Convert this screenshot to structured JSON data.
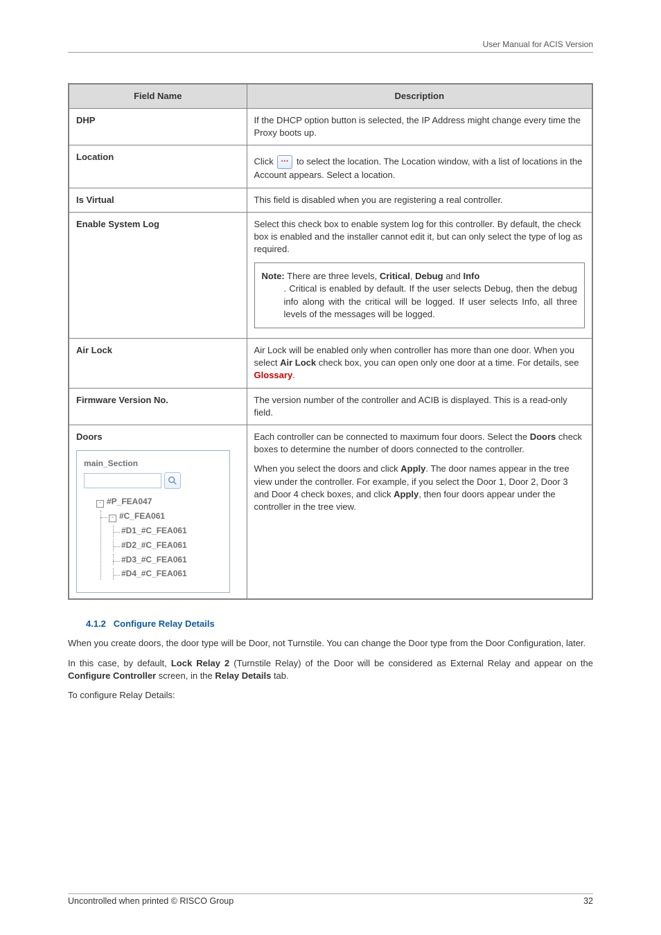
{
  "header": {
    "title": "User Manual for ACIS Version"
  },
  "table": {
    "headers": {
      "field": "Field Name",
      "desc": "Description"
    },
    "rows": {
      "dhp": {
        "label": "DHP",
        "desc": "If the DHCP option button is selected, the IP Address might change every time the Proxy boots up."
      },
      "location": {
        "label": "Location",
        "desc_pre": "Click ",
        "desc_post": " to select the location. The Location window, with a list of locations in the Account appears. Select a location."
      },
      "is_virtual": {
        "label": "Is Virtual",
        "desc": "This field is disabled when you are registering a real controller."
      },
      "enable_log": {
        "label": "Enable System Log",
        "desc": "Select this check box to enable system log for this controller. By default, the check box is enabled and the installer cannot edit it, but can only select the type of log as required.",
        "note_label": "Note:",
        "note_pre": " There are three levels, ",
        "note_c": "Critical",
        "note_sep1": ", ",
        "note_d": "Debug",
        "note_sep2": " and ",
        "note_i": "Info",
        "note_post": ". Critical is enabled by default. If the user selects Debug, then the debug info along with the critical will be logged. If user selects Info, all three levels of the messages will be logged."
      },
      "air_lock": {
        "label": "Air Lock",
        "desc_pre": "Air Lock will be enabled only when controller has more than one door. When you select ",
        "desc_bold": "Air Lock",
        "desc_mid": " check box, you can open only one door at a time. For details, see ",
        "glossary": "Glossary",
        "desc_post": "."
      },
      "fw": {
        "label": "Firmware Version No.",
        "desc": "The version number of the controller and ACIB is displayed. This is a read-only field."
      },
      "doors": {
        "label": "Doors",
        "p1_pre": "Each controller can be connected to maximum four doors. Select the ",
        "p1_bold": "Doors",
        "p1_post": " check boxes to determine the number of doors connected to the controller.",
        "p2_pre": "When you select the doors and click ",
        "p2_b1": "Apply",
        "p2_mid": ". The door names appear in the tree view under the controller. For example, if you select the Door 1, Door 2, Door 3 and Door 4 check boxes, and click ",
        "p2_b2": "Apply",
        "p2_post": ", then four doors appear under the controller in the tree view.",
        "tree": {
          "root": "main_Section",
          "p": "#P_FEA047",
          "c": "#C_FEA061",
          "d1": "#D1_#C_FEA061",
          "d2": "#D2_#C_FEA061",
          "d3": "#D3_#C_FEA061",
          "d4": "#D4_#C_FEA061"
        }
      }
    }
  },
  "section": {
    "number": "4.1.2",
    "title": "Configure Relay Details",
    "para1": "When you create doors, the door type will be Door, not Turnstile. You can change the Door type from the Door Configuration, later.",
    "para2_pre": "In this case, by default, ",
    "para2_b1": "Lock Relay 2",
    "para2_mid1": " (Turnstile Relay) of the Door will be considered as External Relay and appear on the ",
    "para2_b2": "Configure Controller",
    "para2_mid2": " screen, in the ",
    "para2_b3": "Relay Details",
    "para2_post": " tab.",
    "para3": "To configure Relay Details:"
  },
  "footer": {
    "left": "Uncontrolled when printed © RISCO Group",
    "right": "32"
  }
}
